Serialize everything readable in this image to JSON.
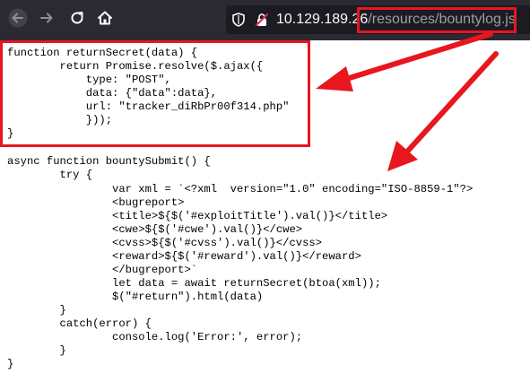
{
  "browser": {
    "back_icon": "back-arrow-icon",
    "forward_icon": "forward-arrow-icon",
    "reload_icon": "reload-icon",
    "home_icon": "home-icon",
    "shield_icon": "tracking-shield-icon",
    "insecure_icon": "insecure-lock-icon",
    "url_host": "10.129.189.26",
    "url_path": "/resources/bountylog.js"
  },
  "colors": {
    "toolbar": "#2b2a33",
    "urlbar": "#1c1b22",
    "highlight": "#e8161e"
  },
  "code": {
    "lines": [
      "function returnSecret(data) {",
      "        return Promise.resolve($.ajax({",
      "            type: \"POST\",",
      "            data: {\"data\":data},",
      "            url: \"tracker_diRbPr00f314.php\"",
      "            }));",
      "}",
      "",
      "async function bountySubmit() {",
      "        try {",
      "                var xml = `<?xml  version=\"1.0\" encoding=\"ISO-8859-1\"?>",
      "                <bugreport>",
      "                <title>${$('#exploitTitle').val()}</title>",
      "                <cwe>${$('#cwe').val()}</cwe>",
      "                <cvss>${$('#cvss').val()}</cvss>",
      "                <reward>${$('#reward').val()}</reward>",
      "                </bugreport>`",
      "                let data = await returnSecret(btoa(xml));",
      "                $(\"#return\").html(data)",
      "        }",
      "        catch(error) {",
      "                console.log('Error:', error);",
      "        }",
      "}"
    ]
  }
}
